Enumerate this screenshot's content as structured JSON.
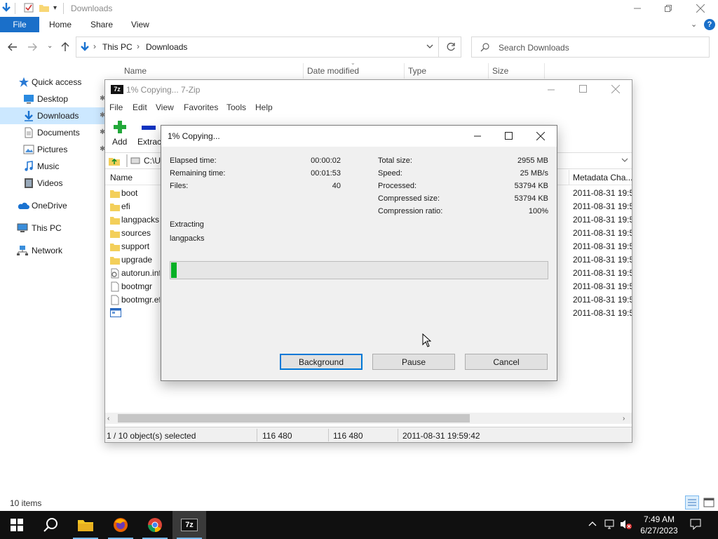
{
  "explorer": {
    "title": "Downloads",
    "ribbon_tabs": [
      "File",
      "Home",
      "Share",
      "View"
    ],
    "breadcrumb": [
      "This PC",
      "Downloads"
    ],
    "search_placeholder": "Search Downloads",
    "columns": [
      "Name",
      "Date modified",
      "Type",
      "Size"
    ],
    "nav": [
      {
        "label": "Quick access",
        "icon": "star-icon"
      },
      {
        "label": "Desktop",
        "icon": "desktop-icon"
      },
      {
        "label": "Downloads",
        "icon": "download-icon",
        "selected": true
      },
      {
        "label": "Documents",
        "icon": "documents-icon"
      },
      {
        "label": "Pictures",
        "icon": "pictures-icon"
      },
      {
        "label": "Music",
        "icon": "music-icon"
      },
      {
        "label": "Videos",
        "icon": "videos-icon"
      },
      {
        "label": "OneDrive",
        "icon": "cloud-icon"
      },
      {
        "label": "This PC",
        "icon": "computer-icon"
      },
      {
        "label": "Network",
        "icon": "network-icon"
      }
    ],
    "status": "10 items"
  },
  "zip": {
    "title": "1% Copying... 7-Zip",
    "menu": [
      "File",
      "Edit",
      "View",
      "Favorites",
      "Tools",
      "Help"
    ],
    "toolbar": {
      "add": "Add",
      "extract": "Extract"
    },
    "path": "C:\\U",
    "columns": {
      "name": "Name",
      "metadata": "Metadata Cha..."
    },
    "files": [
      {
        "name": "boot",
        "type": "folder",
        "date": "2011-08-31 19:5"
      },
      {
        "name": "efi",
        "type": "folder",
        "date": "2011-08-31 19:5"
      },
      {
        "name": "langpacks",
        "type": "folder",
        "date": "2011-08-31 19:5"
      },
      {
        "name": "sources",
        "type": "folder",
        "date": "2011-08-31 19:5"
      },
      {
        "name": "support",
        "type": "folder",
        "date": "2011-08-31 19:5"
      },
      {
        "name": "upgrade",
        "type": "folder",
        "date": "2011-08-31 19:5"
      },
      {
        "name": "autorun.inf",
        "type": "settings",
        "date": "2011-08-31 19:5"
      },
      {
        "name": "bootmgr",
        "type": "file",
        "date": "2011-08-31 19:5"
      },
      {
        "name": "bootmgr.efi",
        "type": "file",
        "date": "2011-08-31 19:5"
      },
      {
        "name": "",
        "type": "app",
        "date": "2011-08-31 19:5"
      }
    ],
    "status": {
      "selected": "1 / 10 object(s) selected",
      "size1": "116 480",
      "size2": "116 480",
      "modified": "2011-08-31 19:59:42"
    }
  },
  "dialog": {
    "title": "1% Copying...",
    "left_stats": [
      {
        "label": "Elapsed time:",
        "value": "00:00:02"
      },
      {
        "label": "Remaining time:",
        "value": "00:01:53"
      },
      {
        "label": "Files:",
        "value": "40"
      }
    ],
    "right_stats": [
      {
        "label": "Total size:",
        "value": "2955 MB"
      },
      {
        "label": "Speed:",
        "value": "25 MB/s"
      },
      {
        "label": "Processed:",
        "value": "53794 KB"
      },
      {
        "label": "Compressed size:",
        "value": "53794 KB"
      },
      {
        "label": "Compression ratio:",
        "value": "100%"
      }
    ],
    "operation": "Extracting",
    "current_item": "langpacks",
    "progress": 0.01,
    "buttons": {
      "background": "Background",
      "pause": "Pause",
      "cancel": "Cancel"
    }
  },
  "taskbar": {
    "time": "7:49 AM",
    "date": "6/27/2023",
    "pinned": [
      "file-explorer",
      "firefox",
      "chrome",
      "7-zip"
    ],
    "colors": {
      "accent": "#0078d7",
      "progress": "#06b025",
      "taskbar": "#101010"
    }
  }
}
